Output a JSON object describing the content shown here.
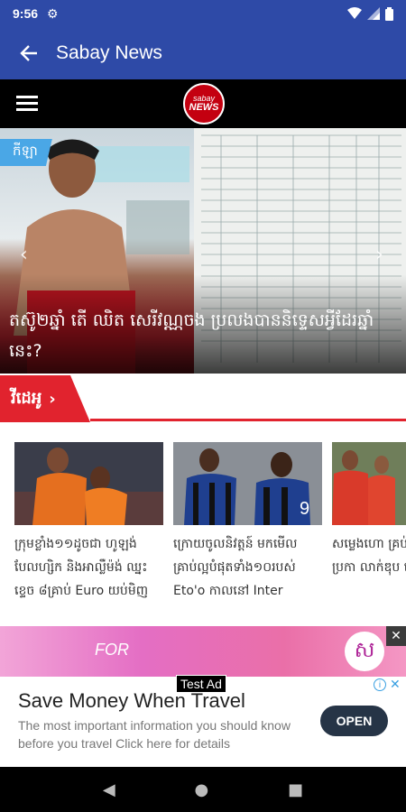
{
  "status_bar": {
    "time": "9:56",
    "icons": [
      "settings-gear-icon",
      "wifi-icon",
      "signal-icon",
      "battery-icon"
    ]
  },
  "app_bar": {
    "title": "Sabay News",
    "back_icon": "arrow-back-icon"
  },
  "site_header": {
    "menu_icon": "hamburger-menu-icon",
    "logo_line1": "sabay",
    "logo_line2": "NEWS"
  },
  "hero": {
    "category_tag": "កីឡា",
    "headline": "តស៊ូ២ឆ្នាំ តើ ឈិត សេរីវណ្ណចង ប្រលងបាននិទ្ទេសអ្វីដែរឆ្នាំនេះ?"
  },
  "section": {
    "label": "វីដេអូ",
    "chevron": "›"
  },
  "cards": [
    {
      "text": "ក្រុមខ្លាំង១១ដូចជា ហូឡង់ បែលហ្សិក និងអាល្លឺម៉ង់ ឈ្នះខ្ទេច ៨គ្រាប់ Euro យប់មិញ"
    },
    {
      "text": "ក្រោយចូលនិវត្តន៍ មកមើល គ្រាប់ល្អបំផុតទាំង១០របស់ Eto'o កាលនៅ Inter"
    },
    {
      "text": "សម្លេងហោ គ្រប់សាលា អំឡុងប្រកា លាក់ឌុប អេ"
    }
  ],
  "ad": {
    "banner_text": "FOR",
    "badge_glyph": "ស",
    "close_glyph": "✕",
    "test_label": "Test Ad",
    "title": "Save Money When Travel",
    "subtitle": "The most important information you should know before you travel Click here for details",
    "cta": "OPEN",
    "info_glyph": "i",
    "x_glyph": "✕"
  },
  "nav_bar": {
    "back": "◀",
    "home": "●",
    "recents": "■"
  },
  "colors": {
    "primary": "#2e4aa7",
    "accent_red": "#e1232e",
    "tag_blue": "#4aa7e6"
  }
}
